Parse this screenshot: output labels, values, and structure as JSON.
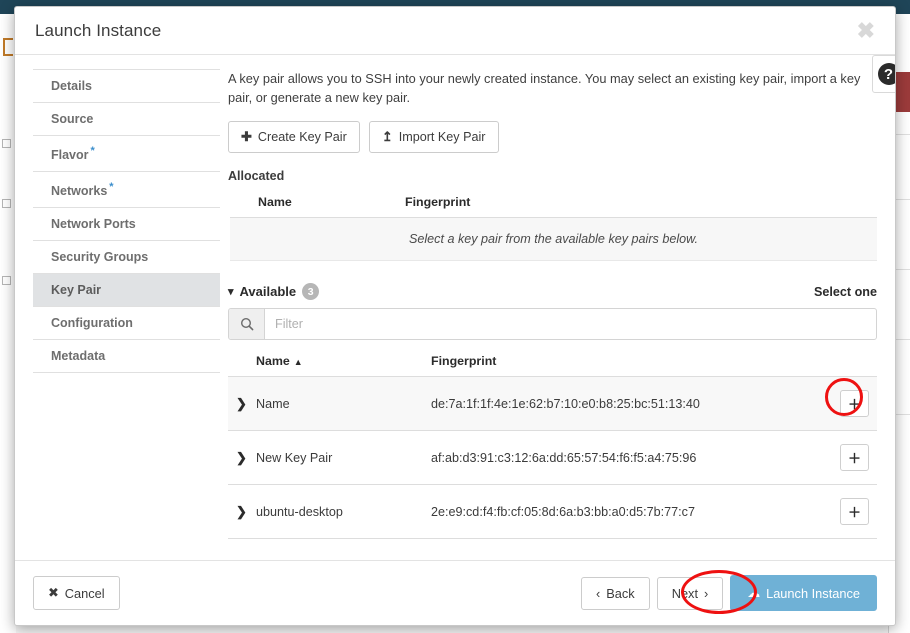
{
  "window": {
    "title": "Launch Instance",
    "close_icon": "close-icon",
    "close_glyph": "✖"
  },
  "sidebar": {
    "items": [
      {
        "label": "Details",
        "required": false,
        "active": false
      },
      {
        "label": "Source",
        "required": false,
        "active": false
      },
      {
        "label": "Flavor",
        "required": true,
        "active": false
      },
      {
        "label": "Networks",
        "required": true,
        "active": false
      },
      {
        "label": "Network Ports",
        "required": false,
        "active": false
      },
      {
        "label": "Security Groups",
        "required": false,
        "active": false
      },
      {
        "label": "Key Pair",
        "required": false,
        "active": true
      },
      {
        "label": "Configuration",
        "required": false,
        "active": false
      },
      {
        "label": "Metadata",
        "required": false,
        "active": false
      }
    ],
    "required_marker": "*"
  },
  "main": {
    "description": "A key pair allows you to SSH into your newly created instance. You may select an existing key pair, import a key pair, or generate a new key pair.",
    "create_key_pair_label": "Create Key Pair",
    "create_key_pair_glyph": "➕",
    "import_key_pair_label": "Import Key Pair",
    "import_key_pair_glyph": "↥",
    "help_glyph": "?",
    "allocated": {
      "title": "Allocated",
      "columns": [
        "Name",
        "Fingerprint"
      ],
      "empty_message": "Select a key pair from the available key pairs below.",
      "rows": []
    },
    "available": {
      "title": "Available",
      "count": "3",
      "collapse_glyph": "⌄",
      "select_hint": "Select one",
      "filter_placeholder": "Filter",
      "filter_value": "",
      "search_icon": "search-icon",
      "columns": [
        "Name",
        "Fingerprint"
      ],
      "sort_column": "Name",
      "sort_caret": "▲",
      "expand_glyph": "❯",
      "add_glyph": "＋",
      "rows": [
        {
          "name": "Name",
          "fingerprint": "de:7a:1f:1f:4e:1e:62:b7:10:e0:b8:25:bc:51:13:40",
          "highlighted": true
        },
        {
          "name": "New Key Pair",
          "fingerprint": "af:ab:d3:91:c3:12:6a:dd:65:57:54:f6:f5:a4:75:96",
          "highlighted": false
        },
        {
          "name": "ubuntu-desktop",
          "fingerprint": "2e:e9:cd:f4:fb:cf:05:8d:6a:b3:bb:a0:d5:7b:77:c7",
          "highlighted": false
        }
      ]
    }
  },
  "footer": {
    "cancel_label": "Cancel",
    "cancel_glyph": "✖",
    "back_label": "Back",
    "back_glyph": "‹",
    "next_label": "Next",
    "next_glyph": "›",
    "launch_label": "Launch Instance",
    "launch_glyph": "☁"
  },
  "annotations": {
    "colors": {
      "highlight_ring": "#ee1111",
      "primary_button": "#6fb1d6",
      "required_star": "#3b8ecc"
    },
    "targets": [
      "add-key-pair-row-0",
      "next-button"
    ]
  }
}
